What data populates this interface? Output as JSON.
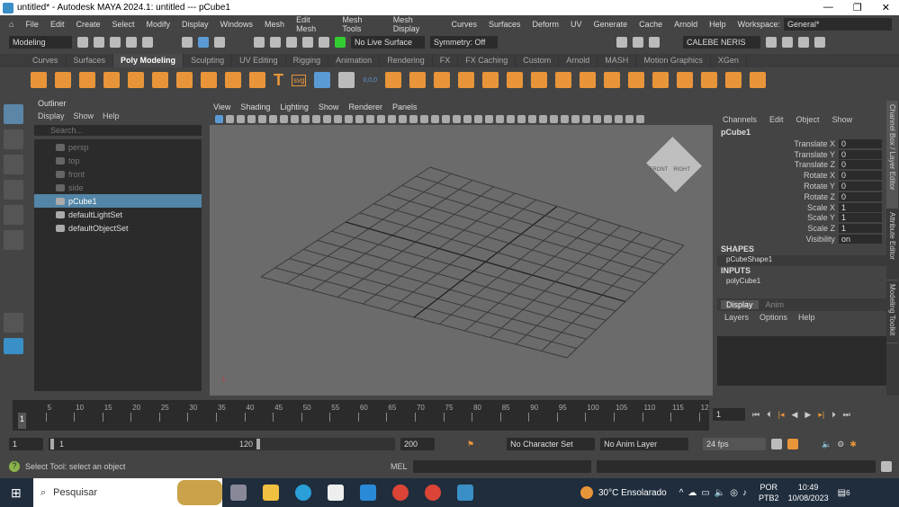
{
  "title": "untitled* - Autodesk MAYA 2024.1: untitled   ---   pCube1",
  "menu": [
    "File",
    "Edit",
    "Create",
    "Select",
    "Modify",
    "Display",
    "Windows",
    "Mesh",
    "Edit Mesh",
    "Mesh Tools",
    "Mesh Display",
    "Curves",
    "Surfaces",
    "Deform",
    "UV",
    "Generate",
    "Cache",
    "Arnold",
    "Help"
  ],
  "workspace_label": "Workspace:",
  "workspace_value": "General*",
  "status": {
    "mode": "Modeling",
    "live_surface": "No Live Surface",
    "symmetry": "Symmetry: Off",
    "user": "CALEBE NERIS"
  },
  "shelf_tabs": [
    "Curves",
    "Surfaces",
    "Poly Modeling",
    "Sculpting",
    "UV Editing",
    "Rigging",
    "Animation",
    "Rendering",
    "FX",
    "FX Caching",
    "Custom",
    "Arnold",
    "MASH",
    "Motion Graphics",
    "XGen"
  ],
  "shelf_active": "Poly Modeling",
  "shelf_text_icons": {
    "text": "T",
    "svg": "svg",
    "uv": "0,0,0"
  },
  "outliner": {
    "title": "Outliner",
    "menu": [
      "Display",
      "Show",
      "Help"
    ],
    "search_placeholder": "Search...",
    "items": [
      {
        "label": "persp",
        "dim": true
      },
      {
        "label": "top",
        "dim": true
      },
      {
        "label": "front",
        "dim": true
      },
      {
        "label": "side",
        "dim": true
      },
      {
        "label": "pCube1",
        "selected": true
      },
      {
        "label": "defaultLightSet"
      },
      {
        "label": "defaultObjectSet"
      }
    ]
  },
  "viewport": {
    "menu": [
      "View",
      "Shading",
      "Lighting",
      "Show",
      "Renderer",
      "Panels"
    ],
    "viewcube": [
      "FRONT",
      "RIGHT"
    ]
  },
  "channel_box": {
    "menu": [
      "Channels",
      "Edit",
      "Object",
      "Show"
    ],
    "object": "pCube1",
    "channels": [
      [
        "Translate X",
        "0"
      ],
      [
        "Translate Y",
        "0"
      ],
      [
        "Translate Z",
        "0"
      ],
      [
        "Rotate X",
        "0"
      ],
      [
        "Rotate Y",
        "0"
      ],
      [
        "Rotate Z",
        "0"
      ],
      [
        "Scale X",
        "1"
      ],
      [
        "Scale Y",
        "1"
      ],
      [
        "Scale Z",
        "1"
      ],
      [
        "Visibility",
        "on"
      ]
    ],
    "shapes_label": "SHAPES",
    "shape": "pCubeShape1",
    "inputs_label": "INPUTS",
    "input": "polyCube1",
    "layer_tabs": [
      "Display",
      "Anim"
    ],
    "layer_menu": [
      "Layers",
      "Options",
      "Help"
    ]
  },
  "side_tabs": [
    "Channel Box / Layer Editor",
    "Attribute Editor",
    "Modeling Toolkit"
  ],
  "timeline": {
    "ticks": [
      "5",
      "10",
      "15",
      "20",
      "25",
      "30",
      "35",
      "40",
      "45",
      "50",
      "55",
      "60",
      "65",
      "70",
      "75",
      "80",
      "85",
      "90",
      "95",
      "100",
      "105",
      "110",
      "115",
      "12"
    ],
    "current": "1",
    "current_field": "1"
  },
  "range": {
    "start": "1",
    "inner_start": "1",
    "inner_end": "120",
    "end": "200",
    "character_set": "No Character Set",
    "anim_layer": "No Anim Layer",
    "fps": "24 fps"
  },
  "command": {
    "help": "Select Tool: select an object",
    "mel": "MEL"
  },
  "taskbar": {
    "search": "Pesquisar",
    "weather": "30°C  Ensolarado",
    "lang1": "POR",
    "lang2": "PTB2",
    "time": "10:49",
    "date": "10/08/2023",
    "notif": "6"
  }
}
